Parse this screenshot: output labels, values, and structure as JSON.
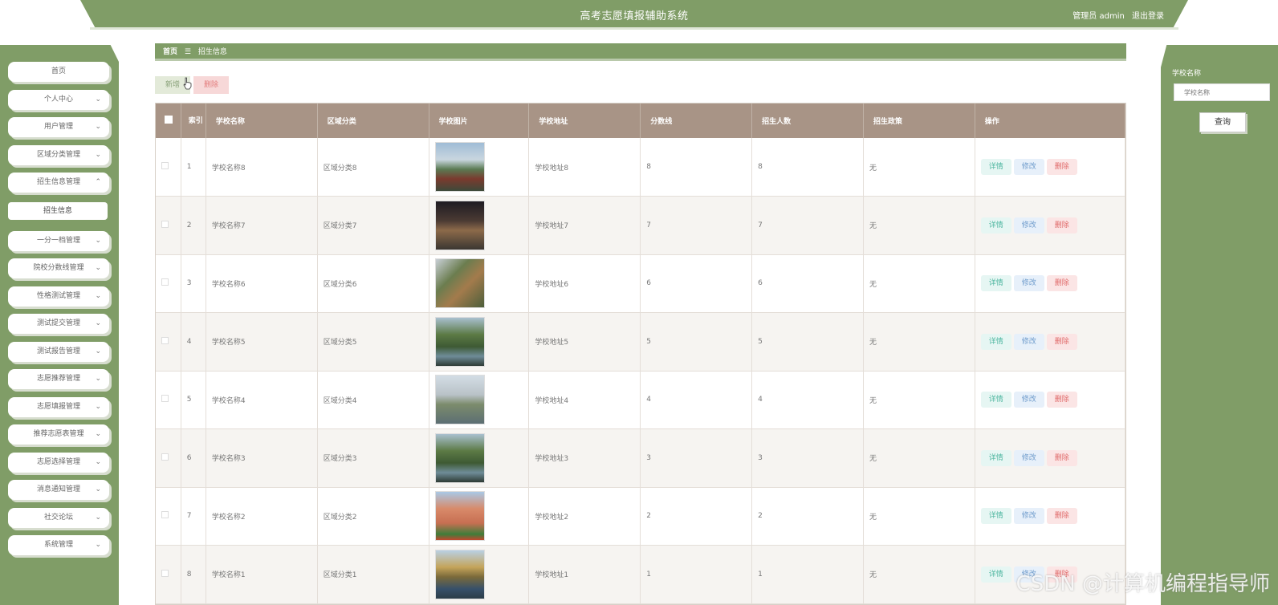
{
  "header": {
    "app_title": "高考志愿填报辅助系统",
    "user_label": "管理员 admin",
    "logout_label": "退出登录"
  },
  "sidebar": {
    "items": [
      {
        "label": "首页",
        "expandable": false
      },
      {
        "label": "个人中心",
        "expandable": true
      },
      {
        "label": "用户管理",
        "expandable": true
      },
      {
        "label": "区域分类管理",
        "expandable": true
      },
      {
        "label": "招生信息管理",
        "expandable": true,
        "expanded": true
      },
      {
        "label": "一分一档管理",
        "expandable": true
      },
      {
        "label": "院校分数线管理",
        "expandable": true
      },
      {
        "label": "性格测试管理",
        "expandable": true
      },
      {
        "label": "测试提交管理",
        "expandable": true
      },
      {
        "label": "测试报告管理",
        "expandable": true
      },
      {
        "label": "志愿推荐管理",
        "expandable": true
      },
      {
        "label": "志愿填报管理",
        "expandable": true
      },
      {
        "label": "推荐志愿表管理",
        "expandable": true
      },
      {
        "label": "志愿选择管理",
        "expandable": true
      },
      {
        "label": "消息通知管理",
        "expandable": true
      },
      {
        "label": "社交论坛",
        "expandable": true
      },
      {
        "label": "系统管理",
        "expandable": true
      }
    ],
    "subitem": "招生信息"
  },
  "breadcrumb": {
    "home": "首页",
    "separator": "☰",
    "current": "招生信息"
  },
  "actions": {
    "add_label": "新增",
    "delete_label": "删除"
  },
  "search": {
    "label": "学校名称",
    "placeholder": "学校名称",
    "button_label": "查询"
  },
  "table": {
    "columns": [
      "索引",
      "学校名称",
      "区域分类",
      "学校图片",
      "学校地址",
      "分数线",
      "招生人数",
      "招生政策",
      "操作"
    ],
    "rows": [
      {
        "index": "1",
        "school": "学校名称8",
        "region": "区域分类8",
        "image_hue": "campus-gate",
        "address": "学校地址8",
        "score": "8",
        "quota": "8",
        "policy": "无"
      },
      {
        "index": "2",
        "school": "学校名称7",
        "region": "区域分类7",
        "image_hue": "night-building",
        "address": "学校地址7",
        "score": "7",
        "quota": "7",
        "policy": "无"
      },
      {
        "index": "3",
        "school": "学校名称6",
        "region": "区域分类6",
        "image_hue": "garden-path",
        "address": "学校地址6",
        "score": "6",
        "quota": "6",
        "policy": "无"
      },
      {
        "index": "4",
        "school": "学校名称5",
        "region": "区域分类5",
        "image_hue": "willow-lake",
        "address": "学校地址5",
        "score": "5",
        "quota": "5",
        "policy": "无"
      },
      {
        "index": "5",
        "school": "学校名称4",
        "region": "区域分类4",
        "image_hue": "library-pond",
        "address": "学校地址4",
        "score": "4",
        "quota": "4",
        "policy": "无"
      },
      {
        "index": "6",
        "school": "学校名称3",
        "region": "区域分类3",
        "image_hue": "willow-lake",
        "address": "学校地址3",
        "score": "3",
        "quota": "3",
        "policy": "无"
      },
      {
        "index": "7",
        "school": "学校名称2",
        "region": "区域分类2",
        "image_hue": "modern-building",
        "address": "学校地址2",
        "score": "2",
        "quota": "2",
        "policy": "无"
      },
      {
        "index": "8",
        "school": "学校名称1",
        "region": "区域分类1",
        "image_hue": "autumn-lake",
        "address": "学校地址1",
        "score": "1",
        "quota": "1",
        "policy": "无"
      }
    ],
    "op_labels": {
      "detail": "详情",
      "edit": "修改",
      "delete": "删除"
    }
  },
  "watermark": "CSDN @计算机编程指导师",
  "colors": {
    "primary_green": "#809d67",
    "table_header": "#a89486",
    "detail": "#4fb7a0",
    "edit": "#6f9ccc",
    "delete": "#e06a6a"
  }
}
